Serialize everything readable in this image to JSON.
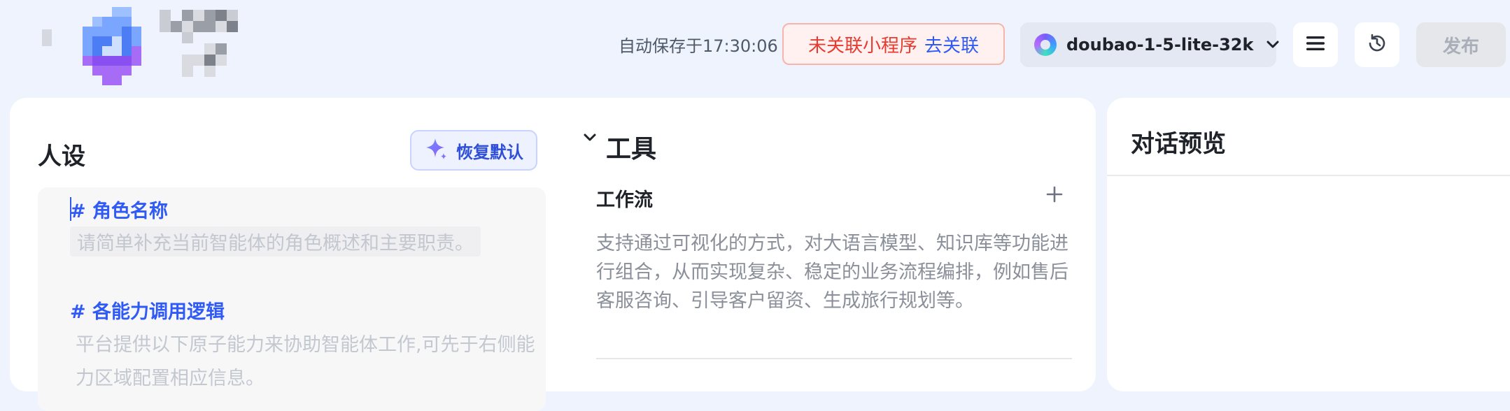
{
  "header": {
    "autosave_text": "自动保存于17:30:06",
    "miniapp_status": "未关联小程序",
    "miniapp_link": "去关联",
    "model": {
      "name": "doubao-1-5-lite-32k",
      "logo_icon": "doubao-logo-icon",
      "chevron_icon": "chevron-down-icon"
    },
    "menu_icon": "menu-icon",
    "history_icon": "history-icon",
    "publish_label": "发布"
  },
  "persona": {
    "title": "人设",
    "restore_label": "恢复默认",
    "restore_icon": "sparkle-icon",
    "sections": [
      {
        "heading": "# 角色名称",
        "placeholder": "请简单补充当前智能体的角色概述和主要职责。"
      },
      {
        "heading": "# 各能力调用逻辑",
        "placeholder": "平台提供以下原子能力来协助智能体工作,可先于右侧能力区域配置相应信息。"
      }
    ]
  },
  "tools": {
    "title": "工具",
    "workflow": {
      "title": "工作流",
      "description": "支持通过可视化的方式，对大语言模型、知识库等功能进行组合，从而实现复杂、稳定的业务流程编排，例如售后客服咨询、引导客户留资、生成旅行规划等。"
    }
  },
  "preview": {
    "title": "对话预览"
  },
  "colors": {
    "accent": "#2f5af5",
    "warning": "#e83b2f",
    "background": "#eef3fd"
  }
}
